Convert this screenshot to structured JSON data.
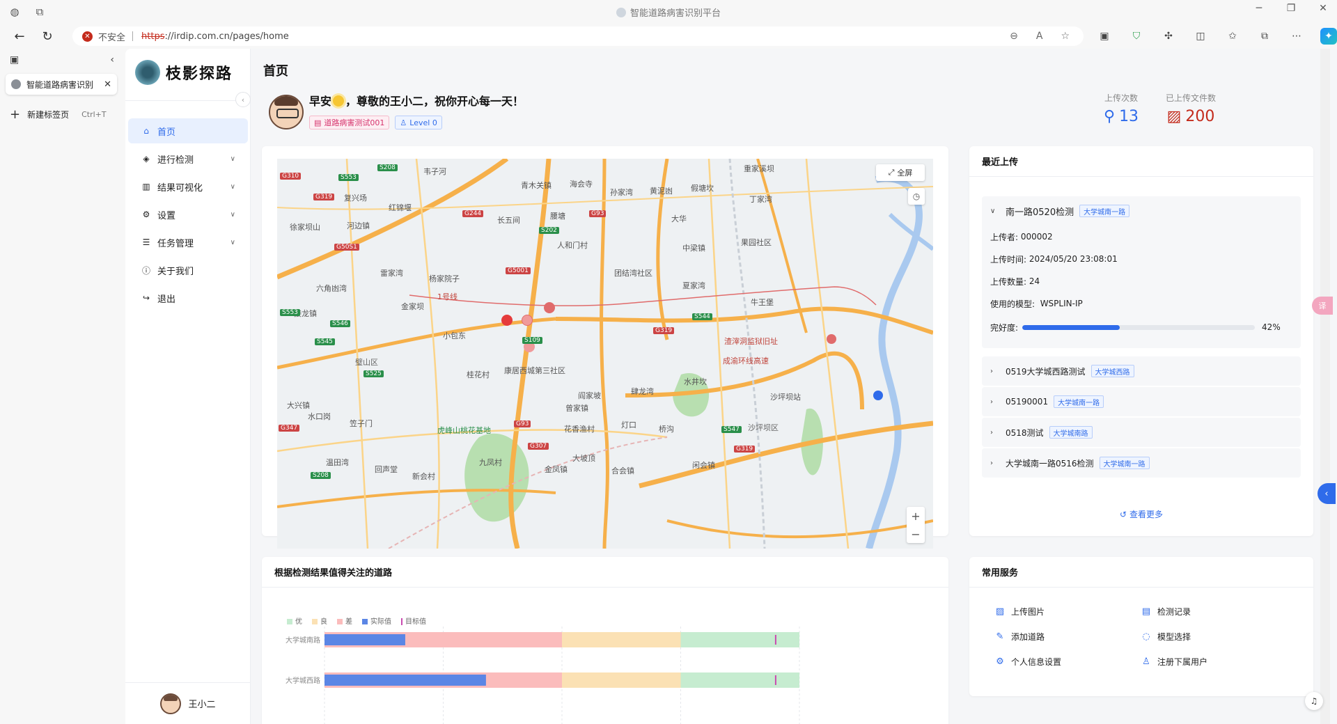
{
  "window": {
    "title": "智能道路病害识别平台"
  },
  "address_bar": {
    "security_label": "不安全",
    "url_protocol": "https",
    "url_rest": "://irdip.com.cn/pages/home"
  },
  "vertical_tabs": {
    "active_tab_title": "智能道路病害识别",
    "new_tab_label": "新建标签页",
    "new_tab_shortcut": "Ctrl+T"
  },
  "sidebar": {
    "logo_text": "枝影探路",
    "items": [
      {
        "label": "首页",
        "icon": "home-icon",
        "active": true,
        "expandable": false
      },
      {
        "label": "进行检测",
        "icon": "cube-icon",
        "active": false,
        "expandable": true
      },
      {
        "label": "结果可视化",
        "icon": "bar-chart-icon",
        "active": false,
        "expandable": true
      },
      {
        "label": "设置",
        "icon": "gears-icon",
        "active": false,
        "expandable": true
      },
      {
        "label": "任务管理",
        "icon": "server-icon",
        "active": false,
        "expandable": true
      },
      {
        "label": "关于我们",
        "icon": "info-icon",
        "active": false,
        "expandable": false
      },
      {
        "label": "退出",
        "icon": "logout-icon",
        "active": false,
        "expandable": false
      }
    ],
    "user_name": "王小二"
  },
  "header": {
    "page_title": "首页",
    "greeting_pre": "早安",
    "greeting_post": "，尊敬的王小二，祝你开心每一天！",
    "tag_project": "道路病害测试001",
    "tag_level": "Level 0",
    "stats": [
      {
        "label": "上传次数",
        "value": "13",
        "icon": "pin-icon"
      },
      {
        "label": "已上传文件数",
        "value": "200",
        "icon": "image-icon"
      }
    ]
  },
  "map": {
    "fullscreen_label": "全屏",
    "labels": [
      {
        "text": "韦子河",
        "k": "town"
      },
      {
        "text": "青木关镇",
        "k": "town"
      },
      {
        "text": "海会寺",
        "k": "town"
      },
      {
        "text": "复兴场",
        "k": "town"
      },
      {
        "text": "红锦堰",
        "k": "town"
      },
      {
        "text": "长五间",
        "k": "town"
      },
      {
        "text": "腰塘",
        "k": "town"
      },
      {
        "text": "孙家湾",
        "k": "town"
      },
      {
        "text": "黄泥凼",
        "k": "town"
      },
      {
        "text": "假塘坎",
        "k": "town"
      },
      {
        "text": "丁家湾",
        "k": "town"
      },
      {
        "text": "徐家坝山",
        "k": "town"
      },
      {
        "text": "河边镇",
        "k": "town"
      },
      {
        "text": "大华",
        "k": "town"
      },
      {
        "text": "人和门村",
        "k": "town"
      },
      {
        "text": "中梁镇",
        "k": "town"
      },
      {
        "text": "果园社区",
        "k": "town"
      },
      {
        "text": "雷家湾",
        "k": "town"
      },
      {
        "text": "杨家院子",
        "k": "town"
      },
      {
        "text": "团结湾社区",
        "k": "town"
      },
      {
        "text": "六角凼湾",
        "k": "town"
      },
      {
        "text": "夏家湾",
        "k": "town"
      },
      {
        "text": "金家坝",
        "k": "town"
      },
      {
        "text": "牛王堡",
        "k": "town"
      },
      {
        "text": "接龙镇",
        "k": "town"
      },
      {
        "text": "小包东",
        "k": "town"
      },
      {
        "text": "渣滓洞监狱旧址",
        "k": "road"
      },
      {
        "text": "璧山区",
        "k": "district"
      },
      {
        "text": "桂花村",
        "k": "town"
      },
      {
        "text": "康居西城第三社区",
        "k": "town"
      },
      {
        "text": "水井坎",
        "k": "town"
      },
      {
        "text": "阎家坡",
        "k": "town"
      },
      {
        "text": "肆龙湾",
        "k": "town"
      },
      {
        "text": "沙坪坝站",
        "k": "town"
      },
      {
        "text": "大兴镇",
        "k": "town"
      },
      {
        "text": "水口岗",
        "k": "town"
      },
      {
        "text": "曾家镇",
        "k": "town"
      },
      {
        "text": "笠子门",
        "k": "town"
      },
      {
        "text": "虎峰山桃花基地",
        "k": "park"
      },
      {
        "text": "花香渔村",
        "k": "town"
      },
      {
        "text": "灯口",
        "k": "town"
      },
      {
        "text": "桥沟",
        "k": "town"
      },
      {
        "text": "沙坪坝区",
        "k": "district"
      },
      {
        "text": "温田湾",
        "k": "town"
      },
      {
        "text": "回声堂",
        "k": "town"
      },
      {
        "text": "九凤村",
        "k": "town"
      },
      {
        "text": "金凤镇",
        "k": "town"
      },
      {
        "text": "大坡顶",
        "k": "town"
      },
      {
        "text": "合会镇",
        "k": "town"
      },
      {
        "text": "新会村",
        "k": "town"
      },
      {
        "text": "闲会镇",
        "k": "town"
      },
      {
        "text": "1号线",
        "k": "road"
      },
      {
        "text": "成渝环线高速",
        "k": "road"
      },
      {
        "text": "重家溪坝",
        "k": "town"
      }
    ],
    "badges": [
      "G310",
      "S553",
      "S208",
      "G319",
      "G244",
      "G93",
      "S202",
      "G50S1",
      "G5001",
      "S544",
      "S546",
      "S545",
      "S109",
      "G347",
      "G93",
      "S547",
      "G319",
      "S208",
      "G307",
      "G319",
      "S525",
      "S553"
    ]
  },
  "recent_uploads": {
    "title": "最近上传",
    "expanded": {
      "name": "南一路0520检测",
      "road": "大学城南一路",
      "uploader_label": "上传者:",
      "uploader": "000002",
      "time_label": "上传时间:",
      "time": "2024/05/20 23:08:01",
      "count_label": "上传数量:",
      "count": "24",
      "model_label": "使用的模型:",
      "model": "WSPLIN-IP",
      "progress_label": "完好度:",
      "progress_pct": 42,
      "progress_text": "42%"
    },
    "collapsed": [
      {
        "name": "0519大学城西路测试",
        "road": "大学城西路"
      },
      {
        "name": "05190001",
        "road": "大学城南一路"
      },
      {
        "name": "0518测试",
        "road": "大学城南路"
      },
      {
        "name": "大学城南一路0516检测",
        "road": "大学城南一路"
      }
    ],
    "see_more": "查看更多"
  },
  "roads_chart": {
    "title": "根据检测结果值得关注的道路",
    "legend": [
      "优",
      "良",
      "差",
      "实际值",
      "目标值"
    ],
    "colors": {
      "good": "#c6ecd0",
      "fair": "#fbe1b4",
      "poor": "#fbbcbc",
      "actual": "#5b86e5",
      "target": "#c94ab0"
    },
    "chart_data": {
      "type": "bar",
      "orientation": "horizontal",
      "categories": [
        "大学城南路",
        "大学城西路"
      ],
      "ranges": [
        {
          "poor": [
            0,
            50
          ],
          "fair": [
            50,
            75
          ],
          "good": [
            75,
            100
          ]
        },
        {
          "poor": [
            0,
            50
          ],
          "fair": [
            50,
            75
          ],
          "good": [
            75,
            100
          ]
        }
      ],
      "actual": [
        17,
        34
      ],
      "target": [
        95,
        95
      ],
      "xlim": [
        0,
        100
      ]
    }
  },
  "services": {
    "title": "常用服务",
    "items": [
      {
        "label": "上传图片",
        "icon": "upload-image-icon"
      },
      {
        "label": "检测记录",
        "icon": "record-icon"
      },
      {
        "label": "添加道路",
        "icon": "edit-icon"
      },
      {
        "label": "模型选择",
        "icon": "loading-icon"
      },
      {
        "label": "个人信息设置",
        "icon": "settings-icon"
      },
      {
        "label": "注册下属用户",
        "icon": "user-icon"
      }
    ]
  }
}
